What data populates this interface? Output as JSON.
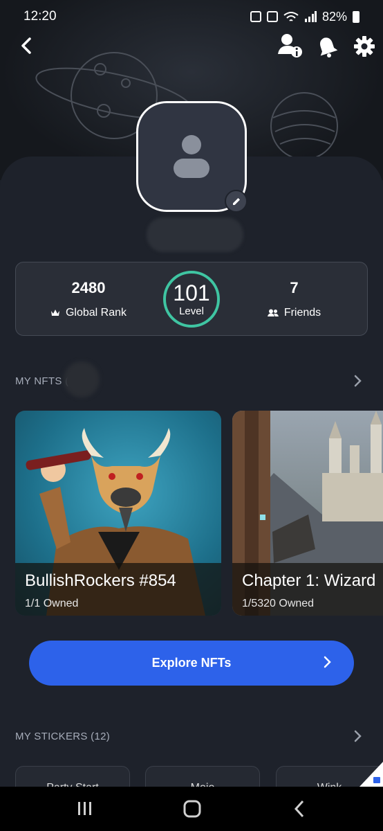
{
  "status_bar": {
    "time": "12:20",
    "battery": "82%"
  },
  "topbar": {
    "back": "back-icon",
    "profile_info": "user-info-icon",
    "notifications": "bell-icon",
    "settings": "gear-icon"
  },
  "stats": {
    "global_rank_value": "2480",
    "global_rank_label": "Global Rank",
    "level_value": "101",
    "level_label": "Level",
    "friends_value": "7",
    "friends_label": "Friends"
  },
  "nfts_section": {
    "title": "MY NFTS (4"
  },
  "nfts": [
    {
      "name": "BullishRockers #854",
      "owned": "1/1 Owned"
    },
    {
      "name": "Chapter 1: Wizard",
      "owned": "1/5320 Owned"
    }
  ],
  "explore_button": {
    "label": "Explore NFTs"
  },
  "stickers_section": {
    "title": "MY STICKERS (12)"
  },
  "stickers": [
    {
      "label": "Party Start"
    },
    {
      "label": "Mojo"
    },
    {
      "label": "Wink"
    }
  ],
  "colors": {
    "accent_blue": "#2d62ea",
    "level_ring": "#3fc5a2",
    "background": "#1e222b"
  }
}
